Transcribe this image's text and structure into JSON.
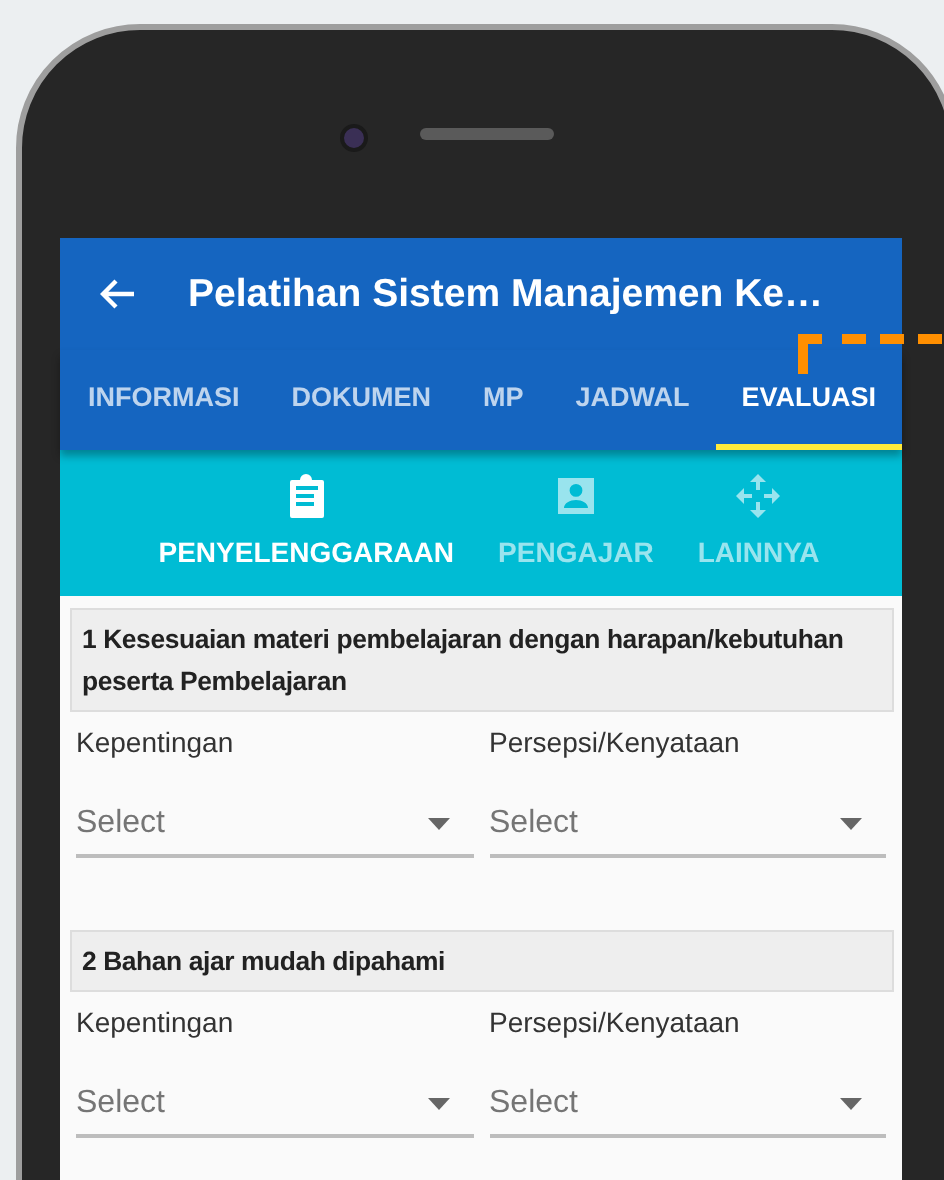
{
  "app_bar": {
    "title": "Pelatihan Sistem Manajemen Ke…"
  },
  "tabs": [
    {
      "label": "INFORMASI",
      "selected": false
    },
    {
      "label": "DOKUMEN",
      "selected": false
    },
    {
      "label": "MP",
      "selected": false
    },
    {
      "label": "JADWAL",
      "selected": false
    },
    {
      "label": "EVALUASI",
      "selected": true
    }
  ],
  "sub_tabs": [
    {
      "label": "PENYELENGGARAAN",
      "selected": true
    },
    {
      "label": "PENGAJAR",
      "selected": false
    },
    {
      "label": "LAINNYA",
      "selected": false
    }
  ],
  "questions": [
    {
      "title": "1 Kesesuaian materi pembelajaran dengan harapan/kebutuhan peserta Pembelajaran",
      "fields": [
        {
          "label": "Kepentingan",
          "placeholder": "Select"
        },
        {
          "label": "Persepsi/Kenyataan",
          "placeholder": "Select"
        }
      ]
    },
    {
      "title": "2 Bahan ajar mudah dipahami",
      "fields": [
        {
          "label": "Kepentingan",
          "placeholder": "Select"
        },
        {
          "label": "Persepsi/Kenyataan",
          "placeholder": "Select"
        }
      ]
    }
  ]
}
